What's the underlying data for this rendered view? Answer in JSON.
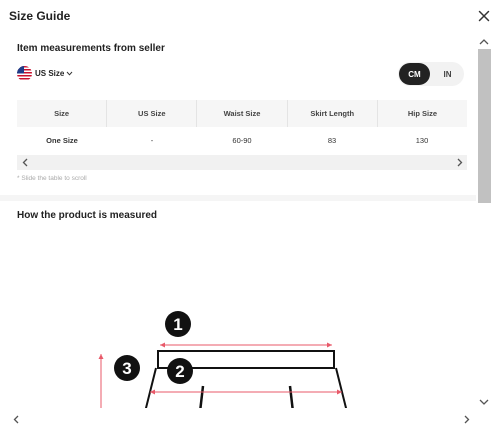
{
  "dialog": {
    "title": "Size Guide"
  },
  "measurements": {
    "title": "Item measurements from seller",
    "unit_selector": {
      "label": "US Size",
      "flag_icon": "us-flag-icon"
    },
    "toggle": {
      "options": [
        "CM",
        "IN"
      ],
      "selected": "CM"
    },
    "table": {
      "headers": [
        "Size",
        "US Size",
        "Waist Size",
        "Skirt Length",
        "Hip Size"
      ],
      "rows": [
        [
          "One Size",
          "-",
          "60-90",
          "83",
          "130"
        ]
      ]
    },
    "hint": "* Slide the table to scroll"
  },
  "how_measured": {
    "title": "How the product is measured",
    "markers": [
      "1",
      "2",
      "3"
    ]
  },
  "colors": {
    "accent": "#222222",
    "header_bg": "#f6f6f6",
    "scroll_thumb": "#c1c1c1"
  }
}
